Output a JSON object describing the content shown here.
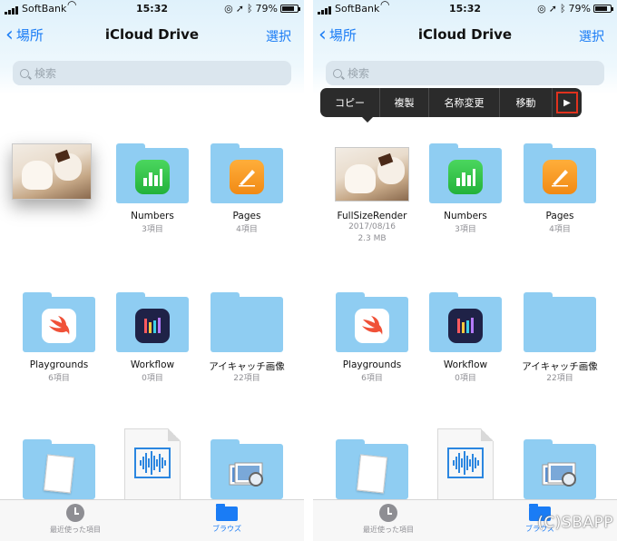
{
  "status": {
    "carrier": "SoftBank",
    "time": "15:32",
    "battery": "79%",
    "battery_level": 0.79
  },
  "nav": {
    "back_label": "場所",
    "title": "iCloud Drive",
    "select_label": "選択"
  },
  "search": {
    "placeholder": "検索"
  },
  "items": {
    "photo": {
      "name": "FullSizeRender",
      "date": "2017/08/16",
      "size": "2.3 MB"
    },
    "numbers": {
      "name": "Numbers",
      "count": "3項目"
    },
    "pages": {
      "name": "Pages",
      "count": "4項目"
    },
    "playgrounds": {
      "name": "Playgrounds",
      "count": "6項目"
    },
    "workflow": {
      "name": "Workflow",
      "count": "0項目"
    },
    "eyecatch": {
      "name": "アイキャッチ画像",
      "count": "22項目"
    }
  },
  "context_menu": {
    "items": [
      "コピー",
      "複製",
      "名称変更",
      "移動"
    ],
    "more_glyph": "▶"
  },
  "tabbar": {
    "recents_label": "最近使った項目",
    "browse_label": "ブラウズ"
  },
  "watermark": "(C)SBAPP",
  "colors": {
    "accent": "#1a7cf5",
    "folder": "#8fcdf2",
    "highlight": "#e0321e"
  },
  "icons": [
    "search-icon",
    "chevron-left-icon",
    "clock-icon",
    "folder-icon",
    "numbers-app-icon",
    "pages-app-icon",
    "swift-playgrounds-icon",
    "workflow-app-icon",
    "audio-file-icon",
    "preview-app-icon",
    "notes-icon",
    "more-arrow-icon"
  ]
}
